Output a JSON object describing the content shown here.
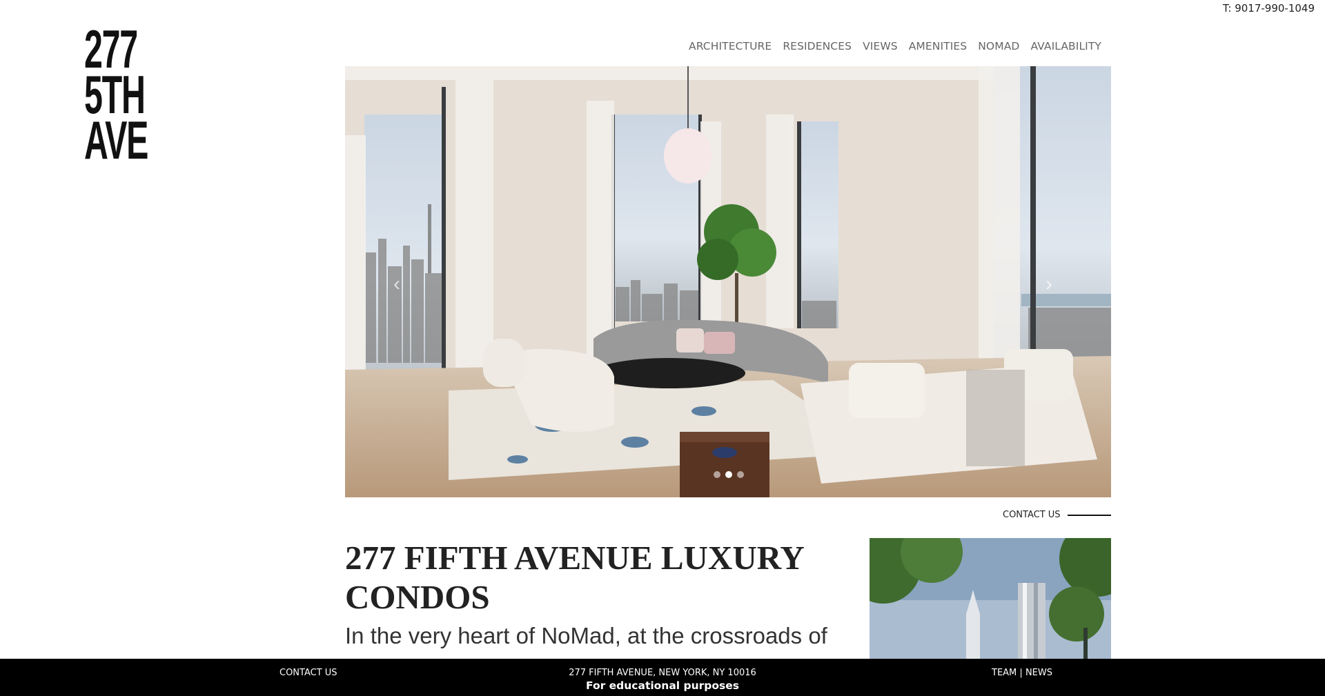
{
  "header": {
    "phone": "T: 9017-990-1049",
    "logo_lines": [
      "277",
      "5TH",
      "AVE"
    ]
  },
  "nav": {
    "items": [
      "ARCHITECTURE",
      "RESIDENCES",
      "VIEWS",
      "AMENITIES",
      "NOMAD",
      "AVAILABILITY"
    ]
  },
  "hero": {
    "image": "living-room-skyline-view",
    "slide_count": 3,
    "active_slide": 2,
    "prev_icon": "chevron-left-icon",
    "next_icon": "chevron-right-icon"
  },
  "main": {
    "contact_label": "CONTACT US",
    "headline": "277 FIFTH AVENUE LUXURY CONDOS",
    "intro": "In the very heart of NoMad, at the crossroads of",
    "thumbnail": "building-exterior-view"
  },
  "footer": {
    "contact": "CONTACT US",
    "address": "277 FIFTH AVENUE, NEW YORK, NY 10016",
    "educational": "For educational purposes",
    "link_team": "TEAM",
    "separator": "|",
    "link_news": "NEWS"
  },
  "colors": {
    "footer_bg": "#000000",
    "nav_text": "#666666",
    "headline": "#222222"
  }
}
